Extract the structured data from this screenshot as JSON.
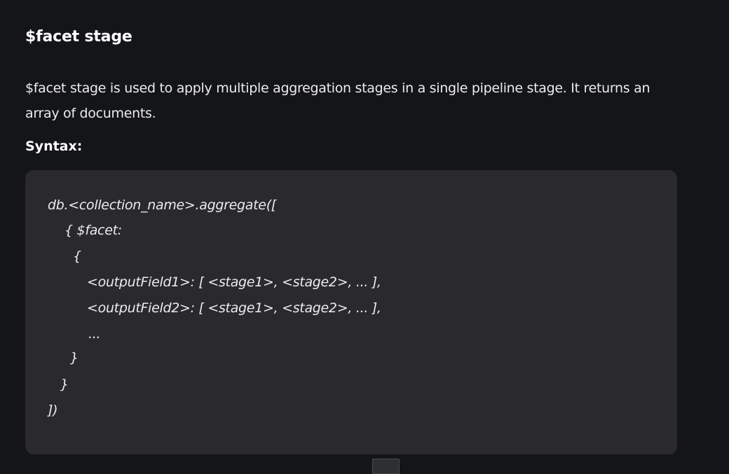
{
  "heading": "$facet stage",
  "description": "$facet stage is used to apply multiple aggregation stages in a single pipeline stage. It returns an array of documents.",
  "syntax_label": "Syntax:",
  "code": {
    "lines": [
      "db.<collection_name>.aggregate([",
      "{ $facet:",
      "{",
      "<outputField1>: [ <stage1>, <stage2>, ... ],",
      "<outputField2>: [ <stage1>, <stage2>, ... ],",
      "...",
      "}",
      "}",
      "])"
    ]
  }
}
